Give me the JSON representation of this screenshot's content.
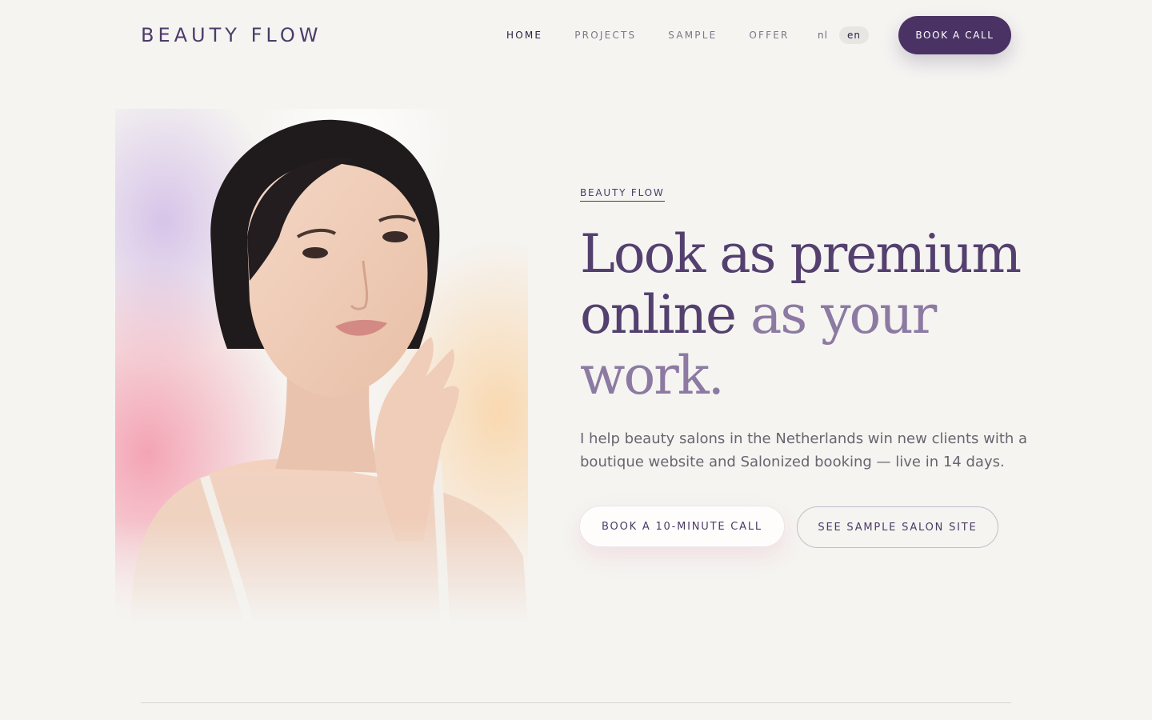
{
  "brand": {
    "logo": "BEAUTY FLOW"
  },
  "nav": {
    "items": [
      {
        "label": "HOME",
        "active": true
      },
      {
        "label": "PROJECTS",
        "active": false
      },
      {
        "label": "SAMPLE",
        "active": false
      },
      {
        "label": "OFFER",
        "active": false
      }
    ]
  },
  "language": {
    "options": [
      "nl",
      "en"
    ],
    "selected": "en"
  },
  "header_cta": {
    "label": "BOOK A CALL"
  },
  "hero": {
    "image_alt_icon": "portrait-photo",
    "eyebrow": "BEAUTY FLOW",
    "headline": {
      "line1": "Look as premium",
      "line2_strong": "online",
      "line2_soft": "as your",
      "line3_soft": "work."
    },
    "subcopy": "I help beauty salons in the Netherlands win new clients with a boutique website and Salonized booking — live in 14 days.",
    "primary_cta": "BOOK A 10-MINUTE CALL",
    "secondary_cta": "SEE SAMPLE SALON SITE"
  },
  "colors": {
    "background": "#f5f4f1",
    "brand_purple": "#4b3264",
    "headline_strong": "#54406f",
    "headline_soft": "#8c7aa3",
    "body_text": "#6a6470"
  }
}
